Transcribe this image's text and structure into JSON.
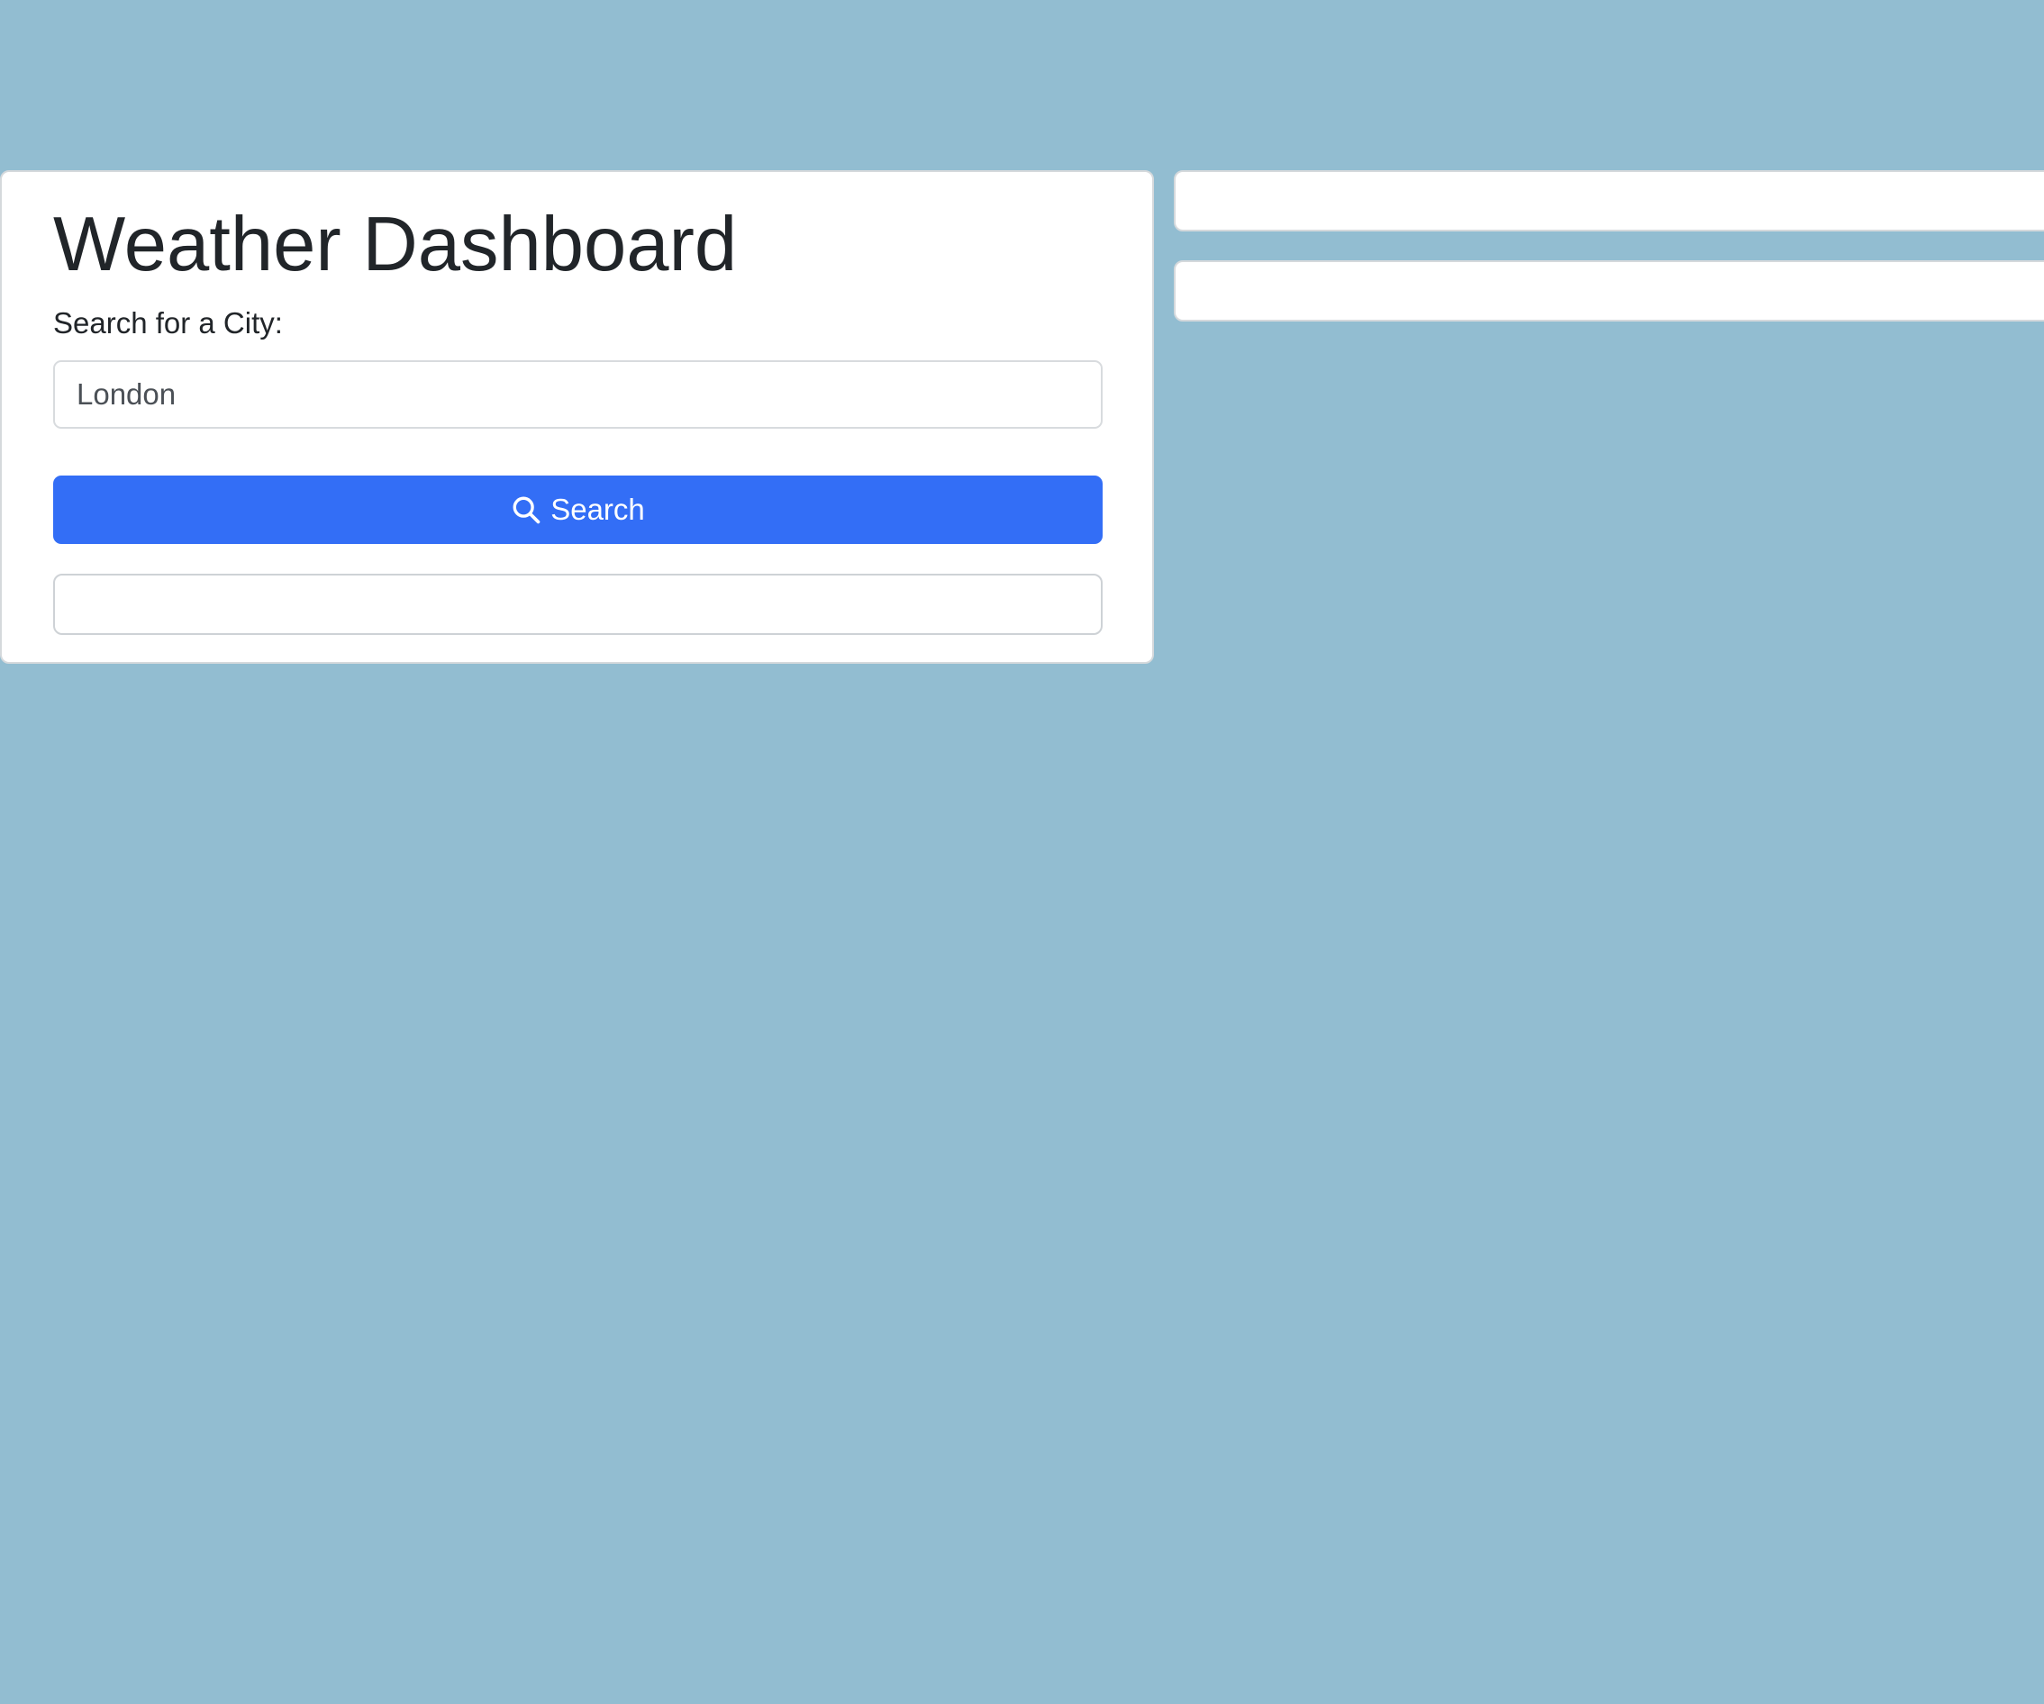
{
  "search_panel": {
    "title": "Weather Dashboard",
    "label": "Search for a City:",
    "city_input": {
      "value": "London",
      "placeholder": ""
    },
    "search_button": {
      "label": "Search",
      "icon": "search-icon"
    },
    "search_history": []
  },
  "current_weather": {},
  "forecast": {},
  "colors": {
    "background": "#92bdd1",
    "button": "#336ef6"
  }
}
